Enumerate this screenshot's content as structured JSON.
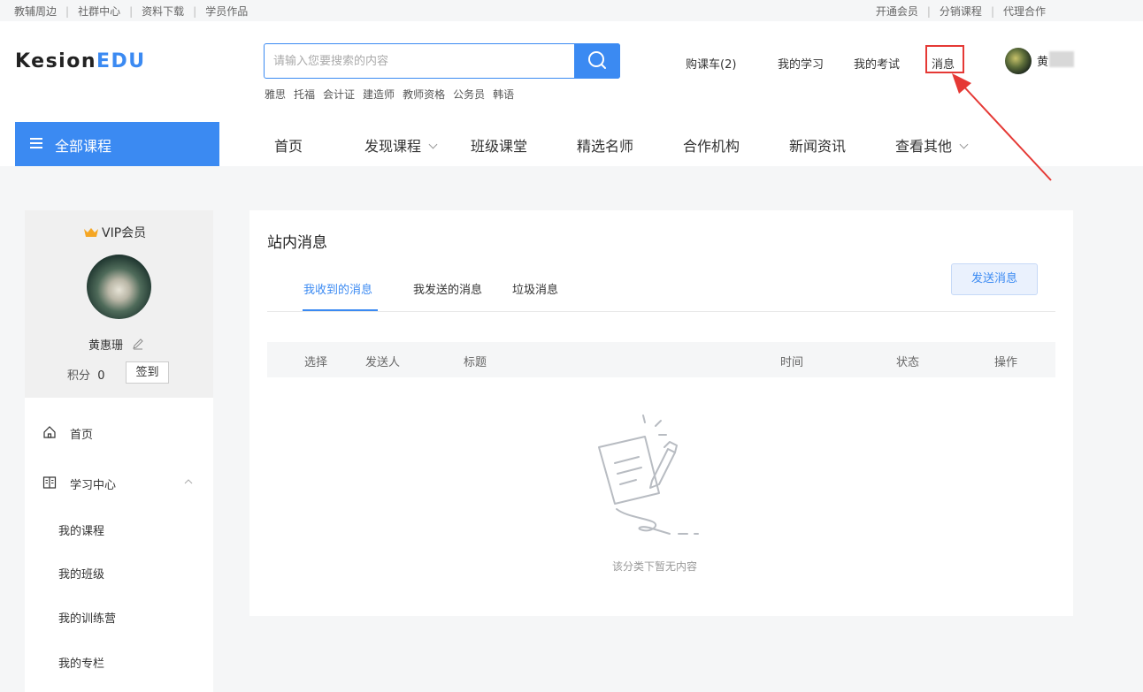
{
  "topbar": {
    "left_links": [
      "教辅周边",
      "社群中心",
      "资料下载",
      "学员作品"
    ],
    "right_links": [
      "开通会员",
      "分销课程",
      "代理合作"
    ]
  },
  "header": {
    "logo_main": "Kesion",
    "logo_accent": "EDU",
    "search_placeholder": "请输入您要搜索的内容",
    "hot_words": [
      "雅思",
      "托福",
      "会计证",
      "建造师",
      "教师资格",
      "公务员",
      "韩语"
    ],
    "nav": {
      "cart": "购课车(2)",
      "study": "我的学习",
      "exam": "我的考试",
      "message": "消息",
      "username": "黄"
    }
  },
  "mainnav": {
    "all_courses": "全部课程",
    "items": [
      "首页",
      "发现课程",
      "班级课堂",
      "精选名师",
      "合作机构",
      "新闻资讯",
      "查看其他"
    ]
  },
  "profile": {
    "vip_label": "VIP会员",
    "name": "黄惠珊",
    "score_label": "积分",
    "score_value": "0",
    "checkin_label": "签到"
  },
  "sidebar": {
    "items": [
      "首页",
      "学习中心",
      "我的课程",
      "我的班级",
      "我的训练营",
      "我的专栏"
    ]
  },
  "content": {
    "title": "站内消息",
    "tabs": [
      "我收到的消息",
      "我发送的消息",
      "垃圾消息"
    ],
    "send_button": "发送消息",
    "columns": [
      "选择",
      "发送人",
      "标题",
      "时间",
      "状态",
      "操作"
    ],
    "empty_text": "该分类下暂无内容"
  },
  "colors": {
    "accent": "#3b8af2",
    "highlight_box": "#e53935"
  }
}
